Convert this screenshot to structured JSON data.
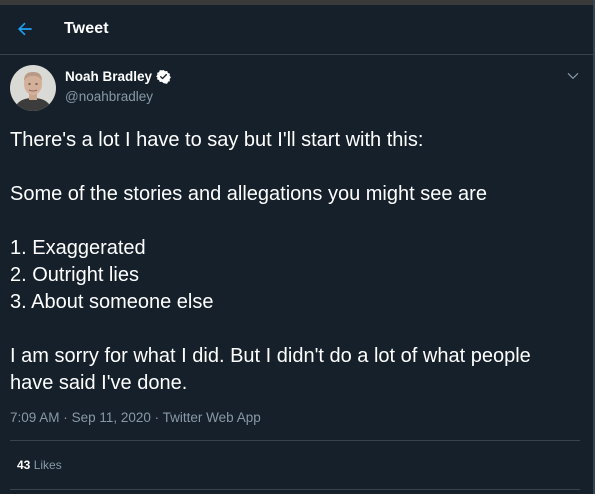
{
  "header": {
    "back_icon": "arrow-left-icon",
    "title": "Tweet"
  },
  "colors": {
    "background": "#15202b",
    "accent": "#1da1f2",
    "secondary_text": "#8899a6",
    "border": "#38444d"
  },
  "tweet": {
    "author": {
      "name": "Noah Bradley",
      "handle": "@noahbradley",
      "verified": true,
      "verified_icon": "verified-badge-icon"
    },
    "menu_icon": "chevron-down-icon",
    "text_lines": [
      "There's a lot I have to say but I'll start with this:",
      "",
      "Some of the stories and allegations you might see are",
      "",
      "1. Exaggerated",
      "2. Outright lies",
      "3. About someone else",
      "",
      "I am sorry for what I did. But I didn't do a lot of what people",
      "have said I've done."
    ],
    "time": "7:09 AM",
    "separator": "·",
    "date": "Sep 11, 2020",
    "source": "Twitter Web App",
    "likes": {
      "count": "43",
      "label": "Likes"
    }
  }
}
